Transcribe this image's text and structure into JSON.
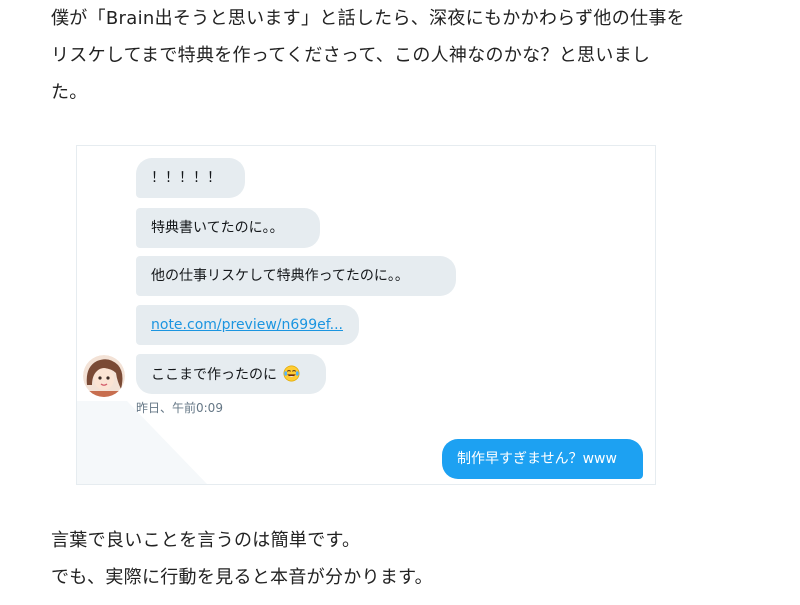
{
  "article": {
    "intro_lines": [
      "僕が「Brain出そうと思います」と話したら、深夜にもかかわらず他の仕事を",
      "リスケしてまで特典を作ってくださって、この人神なのかな？と思いまし",
      "た。"
    ],
    "outro_lines": [
      "言葉で良いことを言うのは簡単です。",
      "でも、実際に行動を見ると本音が分かります。"
    ]
  },
  "dm": {
    "received": [
      {
        "text": "！！！！！"
      },
      {
        "text": "特典書いてたのに。。"
      },
      {
        "text": "他の仕事リスケして特典作ってたのに。。"
      },
      {
        "text": "note.com/preview/n699ef..."
      },
      {
        "text": "ここまで作ったのに",
        "emoji": "face-with-tears-of-joy"
      }
    ],
    "timestamp": "昨日、午前0:09",
    "sent": {
      "text": "制作早すぎません？www"
    },
    "colors": {
      "received_bubble": "#e6ecf0",
      "sent_bubble": "#1da1f2",
      "link": "#1b95e0",
      "timestamp": "#657786"
    }
  }
}
